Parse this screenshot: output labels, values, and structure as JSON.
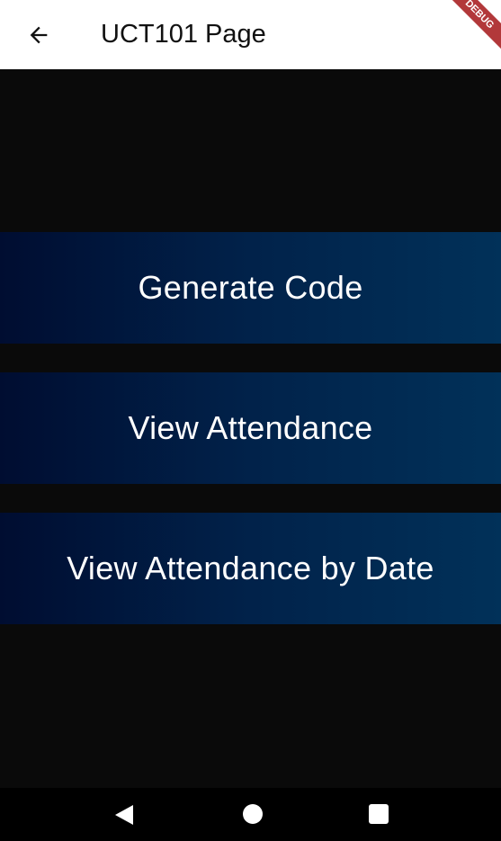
{
  "appbar": {
    "title": "UCT101 Page",
    "back_icon": "arrow-left-icon"
  },
  "debug_banner": {
    "label": "DEBUG",
    "color": "#b2383a"
  },
  "buttons": [
    {
      "label": "Generate Code"
    },
    {
      "label": "View Attendance"
    },
    {
      "label": "View Attendance by Date"
    }
  ],
  "colors": {
    "button_gradient_start": "#000d31",
    "button_gradient_end": "#013159",
    "background": "#0a0a0a"
  },
  "system_nav": {
    "icons": [
      "back-triangle-icon",
      "home-circle-icon",
      "recents-square-icon"
    ]
  }
}
